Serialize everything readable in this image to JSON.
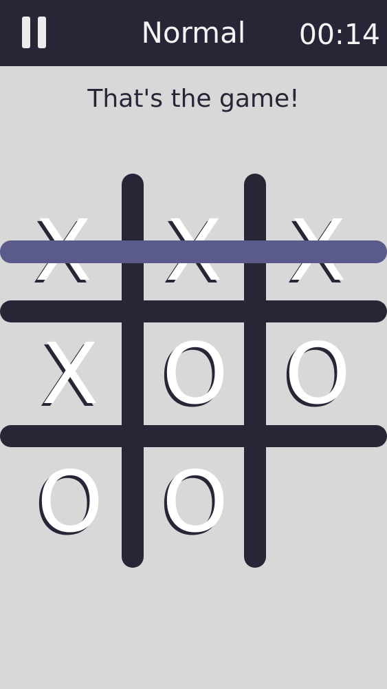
{
  "header": {
    "mode": "Normal",
    "timer": "00:14",
    "pause_icon": "pause-icon"
  },
  "status_message": "That's the game!",
  "board": {
    "cells": [
      [
        "X",
        "X",
        "X"
      ],
      [
        "X",
        "O",
        "O"
      ],
      [
        "O",
        "O",
        ""
      ]
    ],
    "winning_line": "row-1"
  },
  "colors": {
    "background": "#d8d8d8",
    "header": "#262637",
    "grid": "#262637",
    "mark": "#ffffff",
    "win_line": "#5b5b8b"
  }
}
